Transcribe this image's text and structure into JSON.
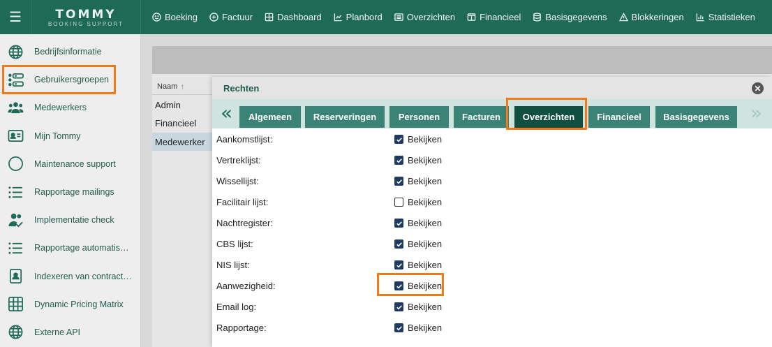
{
  "topbar": {
    "logo_main": "TOMMY",
    "logo_sub": "BOOKING SUPPORT",
    "nav": [
      {
        "label": "Boeking",
        "icon": "smile-icon"
      },
      {
        "label": "Factuur",
        "icon": "plus-circle-icon"
      },
      {
        "label": "Dashboard",
        "icon": "grid-icon"
      },
      {
        "label": "Planbord",
        "icon": "chart-icon"
      },
      {
        "label": "Overzichten",
        "icon": "list-box-icon"
      },
      {
        "label": "Financieel",
        "icon": "window-icon"
      },
      {
        "label": "Basisgegevens",
        "icon": "database-icon"
      },
      {
        "label": "Blokkeringen",
        "icon": "warning-icon"
      },
      {
        "label": "Statistieken",
        "icon": "bar-chart-icon"
      }
    ]
  },
  "sidebar": {
    "items": [
      {
        "label": "Bedrijfsinformatie",
        "icon": "globe-icon"
      },
      {
        "label": "Gebruikersgroepen",
        "icon": "groups-icon"
      },
      {
        "label": "Medewerkers",
        "icon": "people-icon"
      },
      {
        "label": "Mijn Tommy",
        "icon": "id-card-icon"
      },
      {
        "label": "Maintenance support",
        "icon": "circle-icon"
      },
      {
        "label": "Rapportage mailings",
        "icon": "list-icon"
      },
      {
        "label": "Implementatie check",
        "icon": "users-check-icon"
      },
      {
        "label": "Rapportage automatisc…",
        "icon": "list-icon"
      },
      {
        "label": "Indexeren van contract …",
        "icon": "document-icon"
      },
      {
        "label": "Dynamic Pricing Matrix",
        "icon": "table-icon"
      },
      {
        "label": "Externe API",
        "icon": "globe-icon"
      }
    ]
  },
  "table": {
    "column": "Naam",
    "rows": [
      "Admin",
      "Financieel",
      "Medewerker"
    ]
  },
  "dialog": {
    "title": "Rechten",
    "tabs": [
      "Algemeen",
      "Reserveringen",
      "Personen",
      "Facturen",
      "Overzichten",
      "Financieel",
      "Basisgegevens"
    ],
    "active_tab": "Overzichten",
    "permission_label": "Bekijken",
    "permissions": [
      {
        "label": "Aankomstlijst:",
        "checked": true
      },
      {
        "label": "Vertreklijst:",
        "checked": true
      },
      {
        "label": "Wissellijst:",
        "checked": true
      },
      {
        "label": "Facilitair lijst:",
        "checked": false
      },
      {
        "label": "Nachtregister:",
        "checked": true
      },
      {
        "label": "CBS lijst:",
        "checked": true
      },
      {
        "label": "NIS lijst:",
        "checked": true
      },
      {
        "label": "Aanwezigheid:",
        "checked": true
      },
      {
        "label": "Email log:",
        "checked": true
      },
      {
        "label": "Rapportage:",
        "checked": true
      }
    ]
  },
  "colors": {
    "brand_green": "#1e6a57",
    "tab": "#3a8376",
    "tab_active": "#114f43",
    "highlight": "#f07a1a",
    "checkbox": "#1f3a66"
  }
}
